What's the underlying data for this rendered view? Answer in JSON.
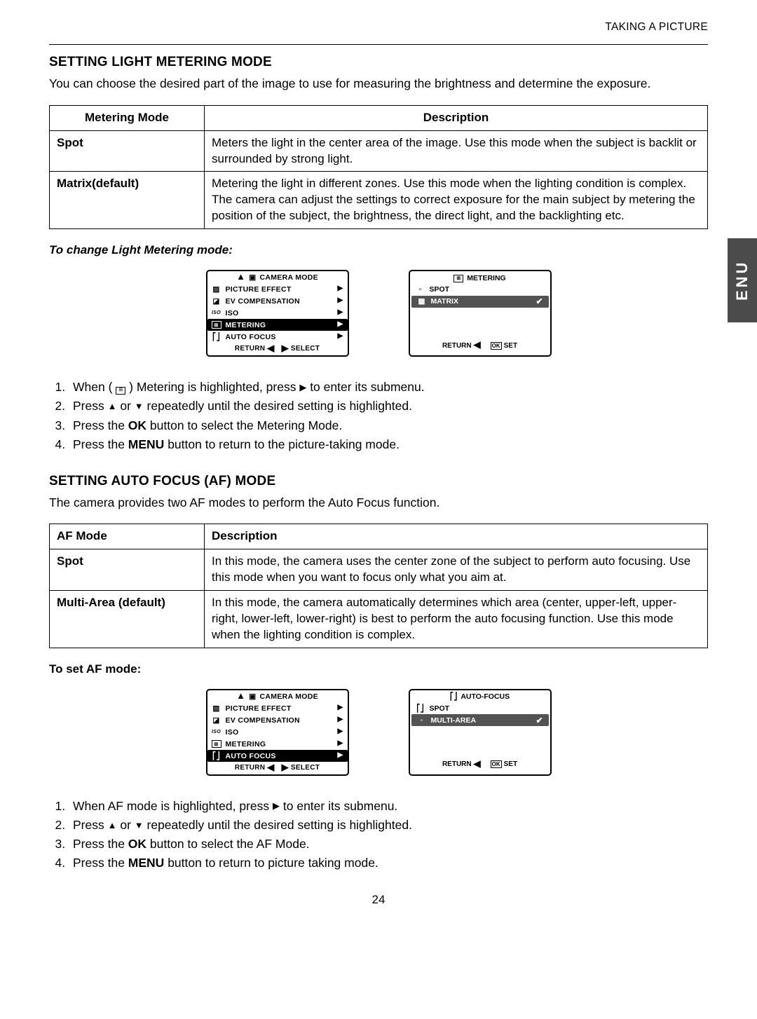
{
  "header": {
    "breadcrumb": "TAKING A PICTURE"
  },
  "section1": {
    "title": "SETTING LIGHT METERING MODE",
    "intro": "You can choose the desired part of the image to use for measuring the brightness and determine the exposure.",
    "table": {
      "headers": [
        "Metering Mode",
        "Description"
      ],
      "rows": [
        {
          "name": "Spot",
          "desc": "Meters the light in the center area of the image. Use this mode when the subject is backlit or surrounded by strong light."
        },
        {
          "name": "Matrix(default)",
          "desc": "Metering the light in different zones. Use this mode when the lighting condition is complex. The camera can adjust the settings to correct exposure for the main subject by metering the position of the subject, the brightness, the direct light, and the backlighting etc."
        }
      ]
    },
    "sub": "To change Light Metering mode:",
    "menu1": {
      "title": "CAMERA MODE",
      "items": [
        {
          "icon": "effect-icon",
          "label": "PICTURE EFFECT"
        },
        {
          "icon": "ev-icon",
          "label": "EV COMPENSATION"
        },
        {
          "icon": "iso-icon",
          "label": "ISO"
        },
        {
          "icon": "metering-icon",
          "label": "METERING",
          "highlight": true
        },
        {
          "icon": "af-icon",
          "label": "AUTO FOCUS"
        }
      ],
      "footer": {
        "left": "RETURN",
        "right": "SELECT"
      }
    },
    "submenu1": {
      "title": "METERING",
      "items": [
        {
          "icon": "spot-icon",
          "label": "SPOT",
          "selected": false
        },
        {
          "icon": "matrix-icon",
          "label": "MATRIX",
          "selected": true
        }
      ],
      "footer": {
        "left": "RETURN",
        "ok": "OK",
        "right": "SET"
      }
    },
    "steps": [
      "When (  ⊞  ) Metering is highlighted, press ▶ to enter its submenu.",
      "Press ▲ or ▼ repeatedly until the desired setting is highlighted.",
      "Press the OK button to select the Metering Mode.",
      "Press the MENU button to return to the picture-taking mode."
    ]
  },
  "section2": {
    "title": "SETTING AUTO FOCUS (AF) MODE",
    "intro": "The camera provides two AF modes to perform the Auto Focus function.",
    "table": {
      "headers": [
        "AF Mode",
        "Description"
      ],
      "rows": [
        {
          "name": "Spot",
          "desc": "In this mode, the camera uses the center zone of the subject to perform auto focusing. Use this mode when you want to focus only what you aim at."
        },
        {
          "name": "Multi-Area (default)",
          "desc": "In this mode, the camera automatically determines which area (center, upper-left, upper-right, lower-left, lower-right) is best to perform the auto focusing function. Use this mode when the lighting condition is complex."
        }
      ]
    },
    "sub": "To set AF mode:",
    "menu2": {
      "title": "CAMERA MODE",
      "items": [
        {
          "icon": "effect-icon",
          "label": "PICTURE EFFECT"
        },
        {
          "icon": "ev-icon",
          "label": "EV COMPENSATION"
        },
        {
          "icon": "iso-icon",
          "label": "ISO"
        },
        {
          "icon": "metering-icon",
          "label": "METERING"
        },
        {
          "icon": "af-icon",
          "label": "AUTO FOCUS",
          "highlight": true
        }
      ],
      "footer": {
        "left": "RETURN",
        "right": "SELECT"
      }
    },
    "submenu2": {
      "title": "AUTO-FOCUS",
      "items": [
        {
          "icon": "spot-af-icon",
          "label": "SPOT",
          "selected": false
        },
        {
          "icon": "multi-icon",
          "label": "MULTI-AREA",
          "selected": true
        }
      ],
      "footer": {
        "left": "RETURN",
        "ok": "OK",
        "right": "SET"
      }
    },
    "steps": [
      "When AF mode is highlighted, press ▶ to enter its submenu.",
      "Press ▲ or ▼ repeatedly until the desired setting is highlighted.",
      "Press the OK button to select the AF Mode.",
      "Press the MENU button to return to picture taking mode."
    ]
  },
  "sidetab": "ENU",
  "pagenum": "24"
}
